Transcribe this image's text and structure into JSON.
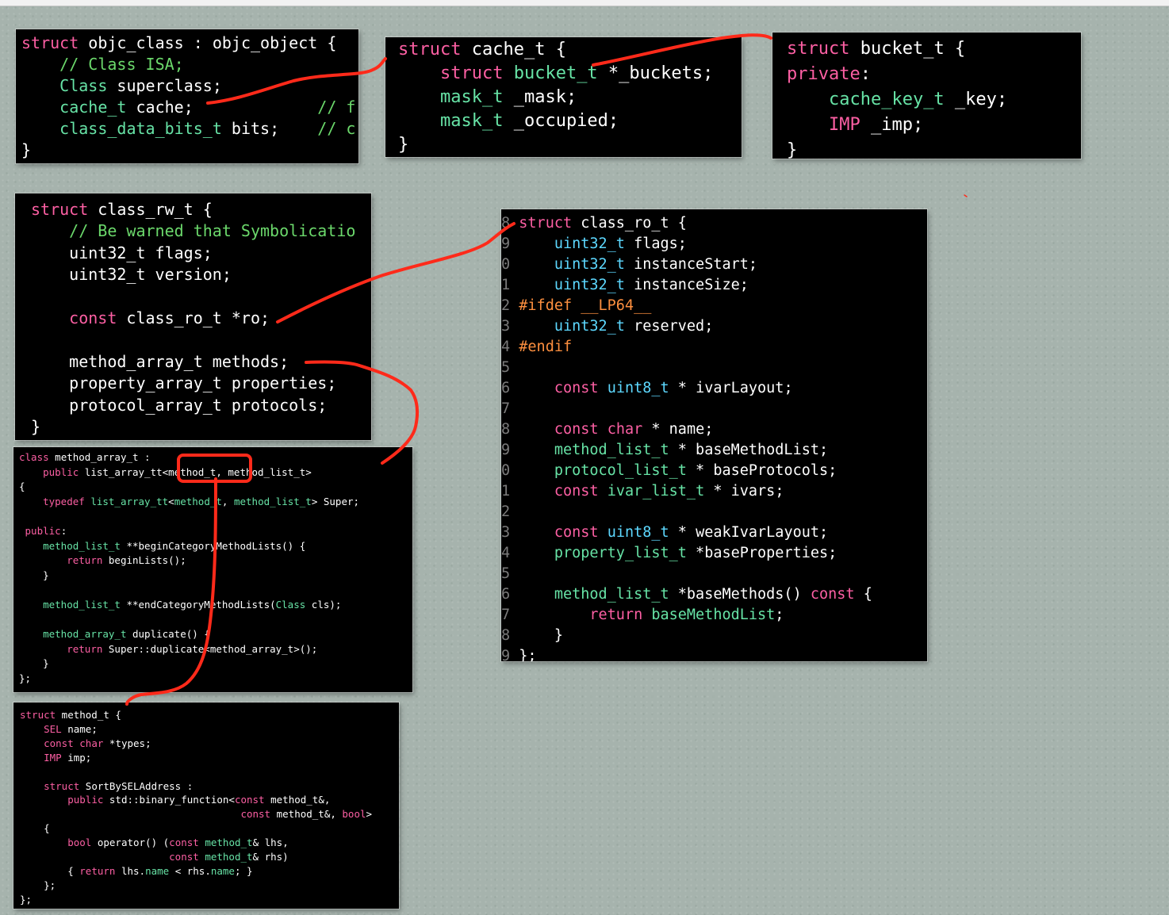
{
  "panels": {
    "objc_class": {
      "lines": [
        [
          {
            "t": "struct",
            "c": "kw"
          },
          {
            "t": " objc_class : objc_object {"
          }
        ],
        [
          {
            "t": "    "
          },
          {
            "t": "// Class ISA;",
            "c": "cm"
          }
        ],
        [
          {
            "t": "    "
          },
          {
            "t": "Class",
            "c": "cls"
          },
          {
            "t": " superclass;"
          }
        ],
        [
          {
            "t": "    "
          },
          {
            "t": "cache_t",
            "c": "cls"
          },
          {
            "t": " cache;             "
          },
          {
            "t": "// f",
            "c": "cm"
          }
        ],
        [
          {
            "t": "    "
          },
          {
            "t": "class_data_bits_t",
            "c": "cls"
          },
          {
            "t": " bits;    "
          },
          {
            "t": "// c",
            "c": "cm"
          }
        ],
        [
          {
            "t": "}"
          }
        ]
      ]
    },
    "cache_t": {
      "lines": [
        [
          {
            "t": "struct",
            "c": "kw"
          },
          {
            "t": " cache_t {"
          }
        ],
        [
          {
            "t": "    "
          },
          {
            "t": "struct",
            "c": "kw"
          },
          {
            "t": " "
          },
          {
            "t": "bucket_t",
            "c": "cls"
          },
          {
            "t": " *_buckets;"
          }
        ],
        [
          {
            "t": "    "
          },
          {
            "t": "mask_t",
            "c": "cls"
          },
          {
            "t": " _mask;"
          }
        ],
        [
          {
            "t": "    "
          },
          {
            "t": "mask_t",
            "c": "cls"
          },
          {
            "t": " _occupied;"
          }
        ],
        [
          {
            "t": "}"
          }
        ]
      ]
    },
    "bucket_t": {
      "lines": [
        [
          {
            "t": "struct",
            "c": "kw"
          },
          {
            "t": " bucket_t {"
          }
        ],
        [
          {
            "t": "private",
            "c": "kw"
          },
          {
            "t": ":"
          }
        ],
        [
          {
            "t": "    "
          },
          {
            "t": "cache_key_t",
            "c": "cls"
          },
          {
            "t": " _key;"
          }
        ],
        [
          {
            "t": "    "
          },
          {
            "t": "IMP",
            "c": "kw"
          },
          {
            "t": " _imp;"
          }
        ],
        [
          {
            "t": "}"
          }
        ]
      ]
    },
    "class_rw_t": {
      "lines": [
        [
          {
            "t": "struct",
            "c": "kw"
          },
          {
            "t": " class_rw_t {"
          }
        ],
        [
          {
            "t": "    "
          },
          {
            "t": "// Be warned that Symbolicatio",
            "c": "cm"
          }
        ],
        [
          {
            "t": "    uint32_t flags;"
          }
        ],
        [
          {
            "t": "    uint32_t version;"
          }
        ],
        [
          {
            "t": ""
          }
        ],
        [
          {
            "t": "    "
          },
          {
            "t": "const",
            "c": "kw"
          },
          {
            "t": " class_ro_t *ro;"
          }
        ],
        [
          {
            "t": ""
          }
        ],
        [
          {
            "t": "    method_array_t methods;"
          }
        ],
        [
          {
            "t": "    property_array_t properties;"
          }
        ],
        [
          {
            "t": "    protocol_array_t protocols;"
          }
        ],
        [
          {
            "t": "}"
          }
        ]
      ]
    },
    "class_ro_t": {
      "lines": [
        [
          {
            "t": "8 ",
            "c": "gut"
          },
          {
            "t": "struct",
            "c": "kw"
          },
          {
            "t": " class_ro_t {"
          }
        ],
        [
          {
            "t": "9 ",
            "c": "gut"
          },
          {
            "t": "    "
          },
          {
            "t": "uint32_t",
            "c": "ty"
          },
          {
            "t": " flags;"
          }
        ],
        [
          {
            "t": "0 ",
            "c": "gut"
          },
          {
            "t": "    "
          },
          {
            "t": "uint32_t",
            "c": "ty"
          },
          {
            "t": " instanceStart;"
          }
        ],
        [
          {
            "t": "1 ",
            "c": "gut"
          },
          {
            "t": "    "
          },
          {
            "t": "uint32_t",
            "c": "ty"
          },
          {
            "t": " instanceSize;"
          }
        ],
        [
          {
            "t": "2 ",
            "c": "gut"
          },
          {
            "t": "#ifdef __LP64__",
            "c": "pp"
          }
        ],
        [
          {
            "t": "3 ",
            "c": "gut"
          },
          {
            "t": "    "
          },
          {
            "t": "uint32_t",
            "c": "ty"
          },
          {
            "t": " reserved;"
          }
        ],
        [
          {
            "t": "4 ",
            "c": "gut"
          },
          {
            "t": "#endif",
            "c": "pp"
          }
        ],
        [
          {
            "t": "5 ",
            "c": "gut"
          }
        ],
        [
          {
            "t": "6 ",
            "c": "gut"
          },
          {
            "t": "    "
          },
          {
            "t": "const",
            "c": "kw"
          },
          {
            "t": " "
          },
          {
            "t": "uint8_t",
            "c": "ty"
          },
          {
            "t": " * ivarLayout;"
          }
        ],
        [
          {
            "t": "7 ",
            "c": "gut"
          }
        ],
        [
          {
            "t": "8 ",
            "c": "gut"
          },
          {
            "t": "    "
          },
          {
            "t": "const",
            "c": "kw"
          },
          {
            "t": " "
          },
          {
            "t": "char",
            "c": "kw"
          },
          {
            "t": " * name;"
          }
        ],
        [
          {
            "t": "9 ",
            "c": "gut"
          },
          {
            "t": "    "
          },
          {
            "t": "method_list_t",
            "c": "cls"
          },
          {
            "t": " * baseMethodList;"
          }
        ],
        [
          {
            "t": "0 ",
            "c": "gut"
          },
          {
            "t": "    "
          },
          {
            "t": "protocol_list_t",
            "c": "cls"
          },
          {
            "t": " * baseProtocols;"
          }
        ],
        [
          {
            "t": "1 ",
            "c": "gut"
          },
          {
            "t": "    "
          },
          {
            "t": "const",
            "c": "kw"
          },
          {
            "t": " "
          },
          {
            "t": "ivar_list_t",
            "c": "cls"
          },
          {
            "t": " * ivars;"
          }
        ],
        [
          {
            "t": "2 ",
            "c": "gut"
          }
        ],
        [
          {
            "t": "3 ",
            "c": "gut"
          },
          {
            "t": "    "
          },
          {
            "t": "const",
            "c": "kw"
          },
          {
            "t": " "
          },
          {
            "t": "uint8_t",
            "c": "ty"
          },
          {
            "t": " * weakIvarLayout;"
          }
        ],
        [
          {
            "t": "4 ",
            "c": "gut"
          },
          {
            "t": "    "
          },
          {
            "t": "property_list_t",
            "c": "cls"
          },
          {
            "t": " *baseProperties;"
          }
        ],
        [
          {
            "t": "5 ",
            "c": "gut"
          }
        ],
        [
          {
            "t": "6 ",
            "c": "gut"
          },
          {
            "t": "    "
          },
          {
            "t": "method_list_t",
            "c": "cls"
          },
          {
            "t": " *baseMethods() "
          },
          {
            "t": "const",
            "c": "kw"
          },
          {
            "t": " {"
          }
        ],
        [
          {
            "t": "7 ",
            "c": "gut"
          },
          {
            "t": "        "
          },
          {
            "t": "return",
            "c": "kw"
          },
          {
            "t": " "
          },
          {
            "t": "baseMethodList",
            "c": "cls"
          },
          {
            "t": ";"
          }
        ],
        [
          {
            "t": "8 ",
            "c": "gut"
          },
          {
            "t": "    }"
          }
        ],
        [
          {
            "t": "9 ",
            "c": "gut"
          },
          {
            "t": "};"
          }
        ]
      ]
    },
    "method_array_t": {
      "lines": [
        [
          {
            "t": "class",
            "c": "kw"
          },
          {
            "t": " method_array_t :"
          }
        ],
        [
          {
            "t": "    "
          },
          {
            "t": "public",
            "c": "kw"
          },
          {
            "t": " list_array_tt<method_t, method_list_t>"
          }
        ],
        [
          {
            "t": "{"
          }
        ],
        [
          {
            "t": "    "
          },
          {
            "t": "typedef",
            "c": "kw"
          },
          {
            "t": " "
          },
          {
            "t": "list_array_tt",
            "c": "cls"
          },
          {
            "t": "<"
          },
          {
            "t": "method_t",
            "c": "cls"
          },
          {
            "t": ", "
          },
          {
            "t": "method_list_t",
            "c": "cls"
          },
          {
            "t": "> Super;"
          }
        ],
        [
          {
            "t": ""
          }
        ],
        [
          {
            "t": " "
          },
          {
            "t": "public",
            "c": "kw"
          },
          {
            "t": ":"
          }
        ],
        [
          {
            "t": "    "
          },
          {
            "t": "method_list_t",
            "c": "cls"
          },
          {
            "t": " **beginCategoryMethodLists() {"
          }
        ],
        [
          {
            "t": "        "
          },
          {
            "t": "return",
            "c": "kw"
          },
          {
            "t": " beginLists();"
          }
        ],
        [
          {
            "t": "    }"
          }
        ],
        [
          {
            "t": ""
          }
        ],
        [
          {
            "t": "    "
          },
          {
            "t": "method_list_t",
            "c": "cls"
          },
          {
            "t": " **endCategoryMethodLists("
          },
          {
            "t": "Class",
            "c": "cls"
          },
          {
            "t": " cls);"
          }
        ],
        [
          {
            "t": ""
          }
        ],
        [
          {
            "t": "    "
          },
          {
            "t": "method_array_t",
            "c": "cls"
          },
          {
            "t": " duplicate() {"
          }
        ],
        [
          {
            "t": "        "
          },
          {
            "t": "return",
            "c": "kw"
          },
          {
            "t": " Super::duplicate<method_array_t>();"
          }
        ],
        [
          {
            "t": "    }"
          }
        ],
        [
          {
            "t": "};"
          }
        ]
      ]
    },
    "method_t": {
      "lines": [
        [
          {
            "t": "struct",
            "c": "kw"
          },
          {
            "t": " method_t {"
          }
        ],
        [
          {
            "t": "    "
          },
          {
            "t": "SEL",
            "c": "kw"
          },
          {
            "t": " name;"
          }
        ],
        [
          {
            "t": "    "
          },
          {
            "t": "const",
            "c": "kw"
          },
          {
            "t": " "
          },
          {
            "t": "char",
            "c": "kw"
          },
          {
            "t": " *types;"
          }
        ],
        [
          {
            "t": "    "
          },
          {
            "t": "IMP",
            "c": "kw"
          },
          {
            "t": " imp;"
          }
        ],
        [
          {
            "t": ""
          }
        ],
        [
          {
            "t": "    "
          },
          {
            "t": "struct",
            "c": "kw"
          },
          {
            "t": " SortBySELAddress :"
          }
        ],
        [
          {
            "t": "        "
          },
          {
            "t": "public",
            "c": "kw"
          },
          {
            "t": " std::binary_function<"
          },
          {
            "t": "const",
            "c": "kw"
          },
          {
            "t": " method_t&,"
          }
        ],
        [
          {
            "t": "                                     "
          },
          {
            "t": "const",
            "c": "kw"
          },
          {
            "t": " method_t&, "
          },
          {
            "t": "bool",
            "c": "kw"
          },
          {
            "t": ">"
          }
        ],
        [
          {
            "t": "    {"
          }
        ],
        [
          {
            "t": "        "
          },
          {
            "t": "bool",
            "c": "kw"
          },
          {
            "t": " operator() ("
          },
          {
            "t": "const",
            "c": "kw"
          },
          {
            "t": " "
          },
          {
            "t": "method_t",
            "c": "cls"
          },
          {
            "t": "& lhs,"
          }
        ],
        [
          {
            "t": "                         "
          },
          {
            "t": "const",
            "c": "kw"
          },
          {
            "t": " "
          },
          {
            "t": "method_t",
            "c": "cls"
          },
          {
            "t": "& rhs)"
          }
        ],
        [
          {
            "t": "        { "
          },
          {
            "t": "return",
            "c": "kw"
          },
          {
            "t": " lhs."
          },
          {
            "t": "name",
            "c": "cls"
          },
          {
            "t": " < rhs."
          },
          {
            "t": "name",
            "c": "cls"
          },
          {
            "t": "; }"
          }
        ],
        [
          {
            "t": "    };"
          }
        ],
        [
          {
            "t": "};"
          }
        ]
      ]
    }
  },
  "colors": {
    "background": "#a6b3ad",
    "panel": "#000000",
    "keyword": "#fc5fa3",
    "type": "#5dd8ff",
    "class_name": "#67e3a6",
    "comment": "#6bd86b",
    "preprocessor": "#fd8f3f",
    "annotation": "#ff2a1a"
  }
}
